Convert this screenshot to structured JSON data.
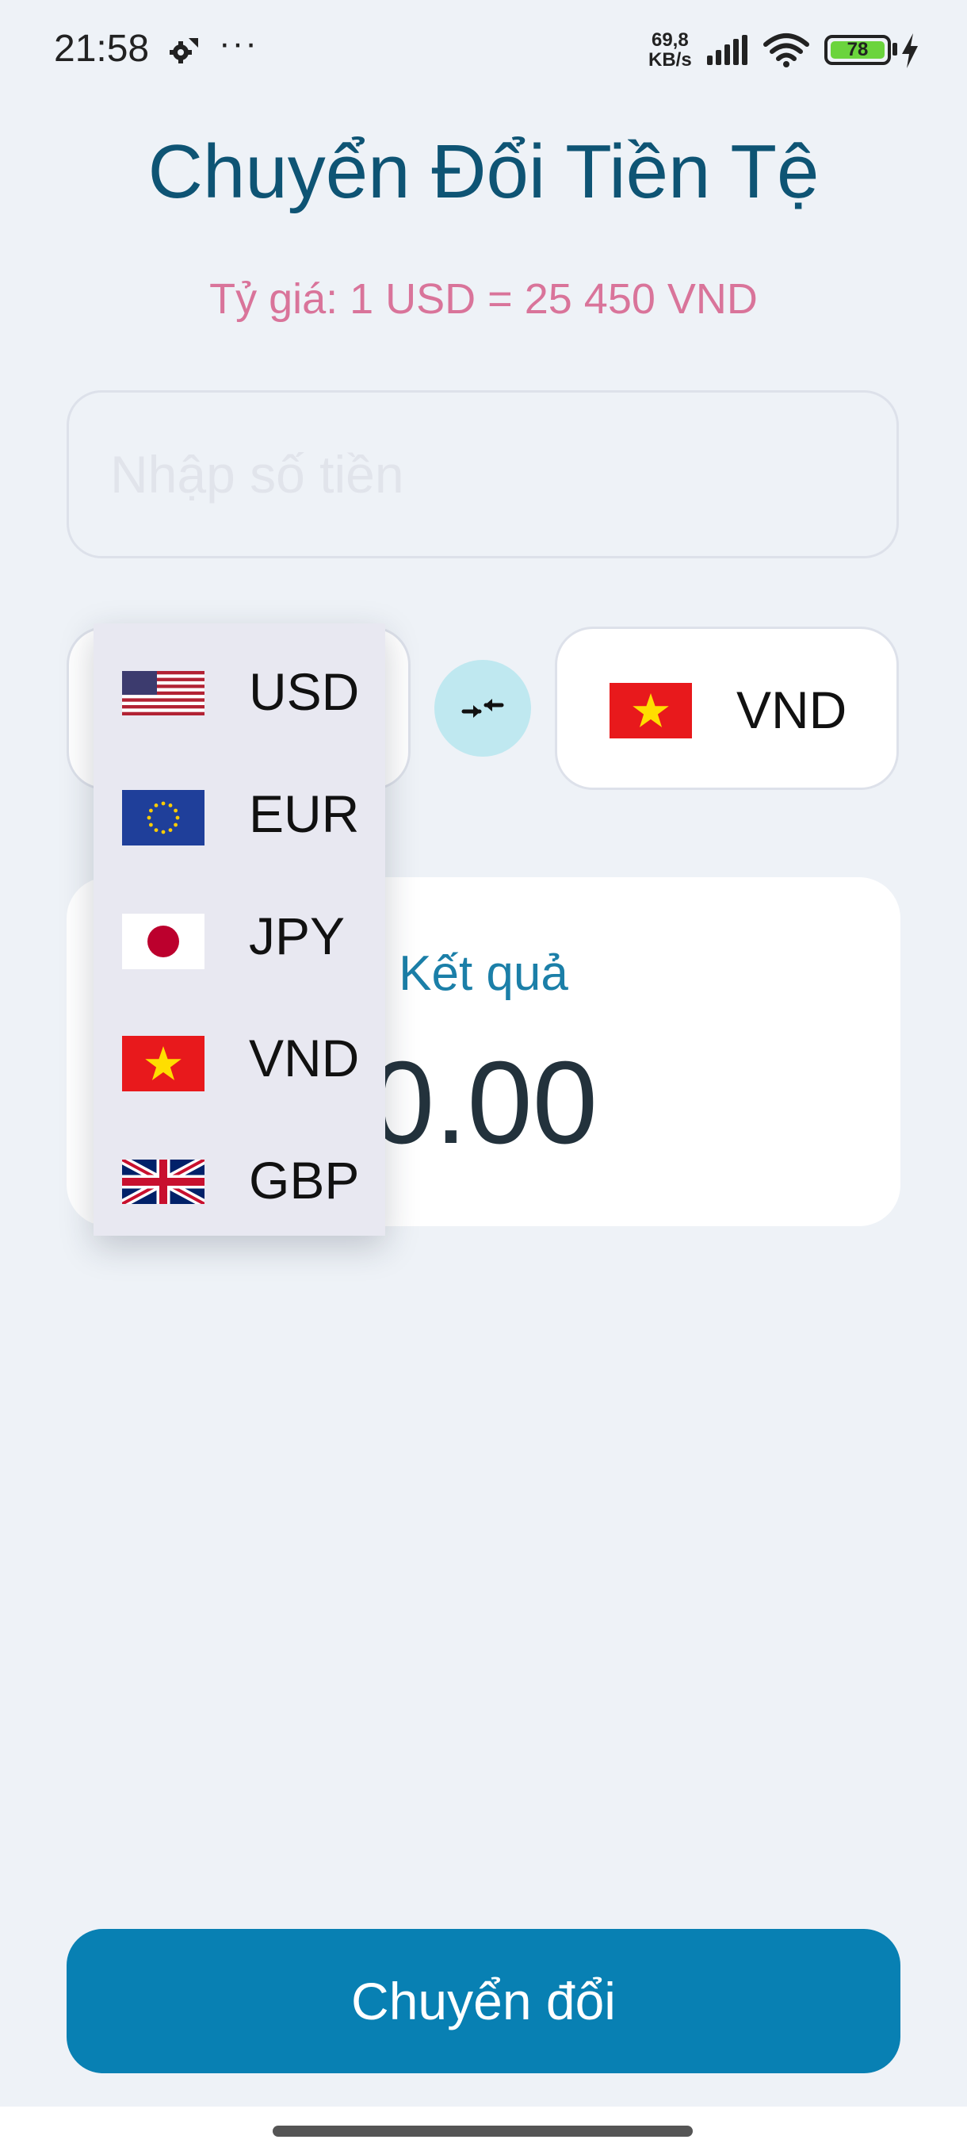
{
  "status_bar": {
    "time": "21:58",
    "more": "···",
    "net_speed_value": "69,8",
    "net_speed_unit": "KB/s",
    "battery": "78"
  },
  "header": {
    "title": "Chuyển Đổi Tiền Tệ",
    "rate": "Tỷ giá: 1 USD = 25 450 VND"
  },
  "amount_input": {
    "value": "",
    "placeholder": "Nhập số tiền"
  },
  "to_currency": {
    "code": "VND",
    "flag": "vietnam-flag-icon"
  },
  "swap": {
    "icon": "swap-arrows-icon"
  },
  "dropdown": {
    "items": [
      {
        "code": "USD",
        "flag": "us-flag-icon"
      },
      {
        "code": "EUR",
        "flag": "eu-flag-icon"
      },
      {
        "code": "JPY",
        "flag": "japan-flag-icon"
      },
      {
        "code": "VND",
        "flag": "vietnam-flag-icon"
      },
      {
        "code": "GBP",
        "flag": "uk-flag-icon"
      }
    ]
  },
  "result": {
    "label": "Kết quả",
    "value": "0.00"
  },
  "convert_button": {
    "label": "Chuyển đổi"
  },
  "colors": {
    "primary": "#0880b3",
    "title": "#0e5474",
    "rate": "#d9749a",
    "background": "#eef2f7"
  }
}
